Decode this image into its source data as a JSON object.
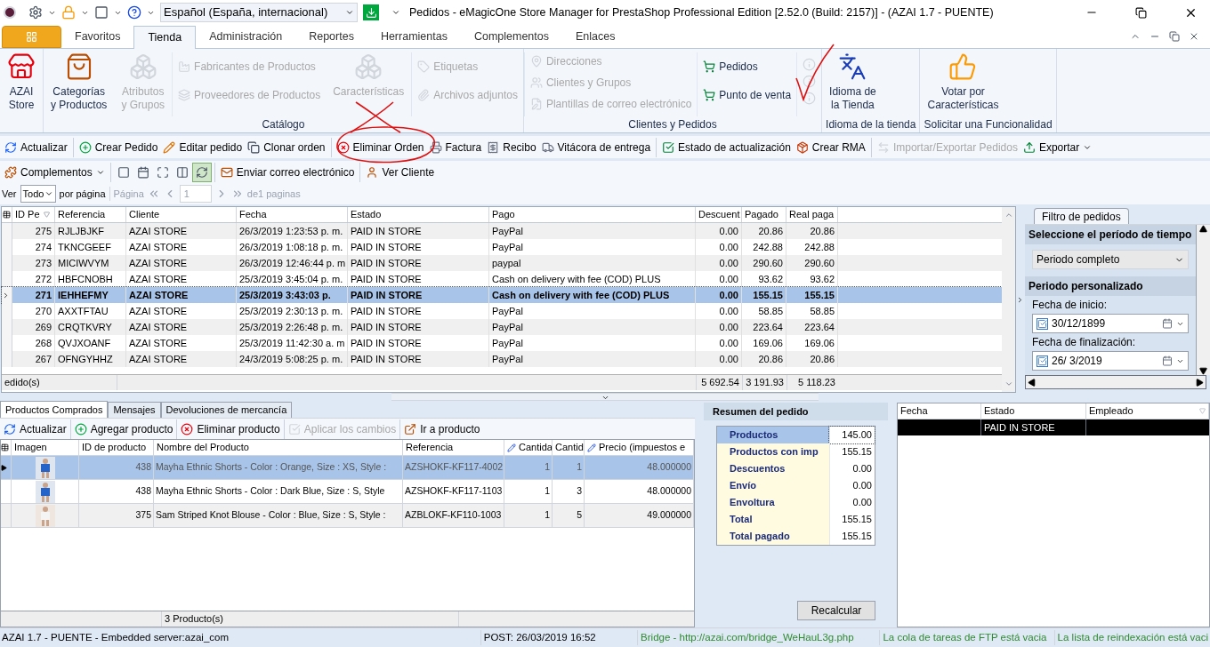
{
  "title_bar": {
    "language": "Español (España, internacional)",
    "title": "Pedidos - eMagicOne Store Manager for PrestaShop Professional Edition [2.52.0 (Build: 2157)] - (AZAI 1.7 - PUENTE)"
  },
  "ribbon": {
    "tabs": [
      {
        "label": "Favoritos",
        "selected": false
      },
      {
        "label": "Tienda",
        "selected": true
      },
      {
        "label": "Administración",
        "selected": false
      },
      {
        "label": "Reportes",
        "selected": false
      },
      {
        "label": "Herramientas",
        "selected": false
      },
      {
        "label": "Complementos",
        "selected": false
      },
      {
        "label": "Enlaces",
        "selected": false
      }
    ],
    "groups": [
      {
        "columns": [
          {
            "kind": "large",
            "label": "AZAI\nStore",
            "disabled": false
          }
        ]
      },
      {
        "label": "Catálogo",
        "columns": [
          {
            "kind": "large",
            "label": "Categorías\ny Productos",
            "disabled": false
          },
          {
            "kind": "large",
            "label": "Atributos\ny Grupos",
            "disabled": true
          },
          {
            "kind": "stack",
            "items": [
              {
                "label": "Fabricantes de Productos",
                "disabled": true
              },
              {
                "label": "Proveedores de Productos",
                "disabled": true
              }
            ]
          },
          {
            "kind": "large",
            "label": "Características",
            "disabled": true
          },
          {
            "kind": "stack",
            "items": [
              {
                "label": "Etiquetas",
                "disabled": true
              },
              {
                "label": "Archivos adjuntos",
                "disabled": true
              }
            ]
          }
        ]
      },
      {
        "label": "Clientes y Pedidos",
        "columns": [
          {
            "kind": "stack",
            "items": [
              {
                "label": "Direcciones",
                "disabled": true
              },
              {
                "label": "Clientes y Grupos",
                "disabled": true
              },
              {
                "label": "Plantillas de correo electrónico",
                "disabled": true
              }
            ]
          },
          {
            "kind": "stack",
            "items": [
              {
                "label": "Pedidos",
                "disabled": false
              },
              {
                "label": "Punto de venta",
                "disabled": false
              }
            ]
          },
          {
            "kind": "icons",
            "items": [
              {
                "disabled": true
              },
              {
                "disabled": true
              },
              {
                "disabled": true
              }
            ]
          }
        ]
      },
      {
        "label": "Idioma de la tienda",
        "columns": [
          {
            "kind": "large",
            "label": "Idioma de\nla Tienda",
            "disabled": false
          }
        ]
      },
      {
        "label": "Solicitar una Funcionalidad",
        "columns": [
          {
            "kind": "large",
            "label": "Votar por\nCaracterísticas",
            "disabled": false
          }
        ]
      }
    ]
  },
  "toolbar_orders": [
    [
      {
        "label": "Actualizar",
        "disabled": false,
        "dropdown": false
      }
    ],
    [
      {
        "label": "Crear Pedido",
        "disabled": false,
        "dropdown": false
      },
      {
        "label": "Editar pedido",
        "disabled": false,
        "dropdown": false
      },
      {
        "label": "Clonar orden",
        "disabled": false,
        "dropdown": false
      }
    ],
    [
      {
        "label": "Eliminar Orden",
        "disabled": false,
        "dropdown": false
      },
      {
        "label": "Factura",
        "disabled": false,
        "dropdown": false
      },
      {
        "label": "Recibo",
        "disabled": false,
        "dropdown": false
      },
      {
        "label": "Vitácora de entrega",
        "disabled": false,
        "dropdown": false
      }
    ],
    [
      {
        "label": "Estado de actualización",
        "disabled": false,
        "dropdown": false
      },
      {
        "label": "Crear RMA",
        "disabled": false,
        "dropdown": false
      }
    ],
    [
      {
        "label": "Importar/Exportar Pedidos",
        "disabled": true,
        "dropdown": false
      },
      {
        "label": "Exportar",
        "disabled": false,
        "dropdown": true
      }
    ]
  ],
  "toolbar_extra": [
    [
      {
        "kind": "text",
        "label": "Complementos",
        "dropdown": true,
        "pressed": false
      }
    ],
    [
      {
        "kind": "icon",
        "pressed": false
      },
      {
        "kind": "icon",
        "pressed": false
      },
      {
        "kind": "icon",
        "pressed": false
      },
      {
        "kind": "icon",
        "pressed": false
      },
      {
        "kind": "icon",
        "pressed": true
      }
    ],
    [
      {
        "kind": "text",
        "label": "Enviar correo electrónico",
        "dropdown": false,
        "pressed": false
      }
    ],
    [
      {
        "kind": "text",
        "label": "Ver Cliente",
        "dropdown": false,
        "pressed": false
      }
    ]
  ],
  "pager": {
    "show_label": "Ver",
    "page_size": "Todo",
    "per_page": "por página",
    "page_label": "Página",
    "page_value": "1",
    "of_pages": "de1 paginas"
  },
  "orders": {
    "columns": [
      "ID Pe",
      "Referencia",
      "Cliente",
      "Fecha",
      "Estado",
      "Pago",
      "Descuent",
      "Pagado",
      "Real paga"
    ],
    "rows": [
      {
        "cells": [
          "275",
          "RJLJBJKF",
          "AZAI  STORE",
          "26/3/2019 1:23:53 p. m.",
          "PAID IN STORE",
          "PayPal",
          "0.00",
          "20.86",
          "20.86"
        ],
        "selected": false
      },
      {
        "cells": [
          "274",
          "TKNCGEEF",
          "AZAI  STORE",
          "26/3/2019 1:08:18 p. m.",
          "PAID IN STORE",
          "PayPal",
          "0.00",
          "242.88",
          "242.88"
        ],
        "selected": false
      },
      {
        "cells": [
          "273",
          "MICIWVYM",
          "AZAI  STORE",
          "26/3/2019 12:46:44 p. m",
          "PAID IN STORE",
          "paypal",
          "0.00",
          "290.60",
          "290.60"
        ],
        "selected": false
      },
      {
        "cells": [
          "272",
          "HBFCNOBH",
          "AZAI  STORE",
          "25/3/2019 3:45:04 p. m.",
          "PAID IN STORE",
          "Cash on delivery with fee (COD) PLUS",
          "0.00",
          "93.62",
          "93.62"
        ],
        "selected": false
      },
      {
        "cells": [
          "271",
          "IEHHEFMY",
          "AZAI  STORE",
          "25/3/2019 3:43:03 p.",
          "PAID IN STORE",
          "Cash on delivery with fee (COD) PLUS",
          "0.00",
          "155.15",
          "155.15"
        ],
        "selected": true
      },
      {
        "cells": [
          "270",
          "AXXTFTAU",
          "AZAI  STORE",
          "25/3/2019 2:30:13 p. m.",
          "PAID IN STORE",
          "PayPal",
          "0.00",
          "58.85",
          "58.85"
        ],
        "selected": false
      },
      {
        "cells": [
          "269",
          "CRQTKVRY",
          "AZAI  STORE",
          "25/3/2019 2:26:48 p. m.",
          "PAID IN STORE",
          "PayPal",
          "0.00",
          "223.64",
          "223.64"
        ],
        "selected": false
      },
      {
        "cells": [
          "268",
          "QVJXOANF",
          "AZAI  STORE",
          "25/3/2019 11:42:30 a. m",
          "PAID IN STORE",
          "PayPal",
          "0.00",
          "169.06",
          "169.06"
        ],
        "selected": false
      },
      {
        "cells": [
          "267",
          "OFNGYHHZ",
          "AZAI  STORE",
          "24/3/2019 5:08:25 p. m.",
          "PAID IN STORE",
          "PayPal",
          "0.00",
          "20.86",
          "20.86"
        ],
        "selected": false
      }
    ],
    "footer": {
      "count": "edido(s)",
      "totals": [
        "5 692.54",
        "3 191.93",
        "5 118.23"
      ]
    }
  },
  "filter": {
    "tab": "Filtro de pedidos",
    "period_title": "Seleccione el período de tiempo",
    "period": "Periodo completo",
    "custom_title": "Periodo personalizado",
    "start_label": "Fecha de inicio:",
    "start": {
      "value": "30/12/1899",
      "checked": true
    },
    "end_label": "Fecha de finalización:",
    "end": {
      "value": "26/  3/2019",
      "checked": true
    }
  },
  "bottom_tabs": [
    {
      "label": "Productos Comprados",
      "selected": true
    },
    {
      "label": "Mensajes",
      "selected": false
    },
    {
      "label": "Devoluciones de mercancía",
      "selected": false
    }
  ],
  "products_toolbar": [
    {
      "label": "Actualizar",
      "disabled": false
    },
    {
      "label": "Agregar producto",
      "disabled": false
    },
    {
      "label": "Eliminar producto",
      "disabled": false
    },
    {
      "label": "Aplicar los cambios",
      "disabled": true
    },
    {
      "label": "Ir a producto",
      "disabled": false
    }
  ],
  "products": {
    "columns": [
      {
        "label": "Imagen",
        "editable": false
      },
      {
        "label": "ID de producto",
        "editable": false
      },
      {
        "label": "Nombre del Producto",
        "editable": false
      },
      {
        "label": "Referencia",
        "editable": false
      },
      {
        "label": "Cantida",
        "editable": true
      },
      {
        "label": "Cantid",
        "editable": false
      },
      {
        "label": "Precio (impuestos e",
        "editable": true
      }
    ],
    "rows": [
      {
        "product_id": "438",
        "name": "Mayha Ethnic Shorts - Color : Orange, Size : XS, Style :",
        "reference": "AZSHOKF-KF117-4002",
        "quantity": "1",
        "quantity_2": "1",
        "price": "48.000000",
        "selected": true
      },
      {
        "product_id": "438",
        "name": "Mayha Ethnic Shorts - Color : Dark Blue, Size : S, Style",
        "reference": "AZSHOKF-KF117-1103",
        "quantity": "1",
        "quantity_2": "3",
        "price": "48.000000",
        "selected": false
      },
      {
        "product_id": "375",
        "name": "Sam Striped Knot Blouse - Color : Blue, Size : S, Style :",
        "reference": "AZBLOKF-KF110-1003",
        "quantity": "1",
        "quantity_2": "5",
        "price": "49.000000",
        "selected": false
      }
    ],
    "footer": "3 Producto(s)"
  },
  "summary": {
    "title": "Resumen del pedido",
    "rows": [
      {
        "label": "Productos",
        "value": "145.00",
        "selected": true
      },
      {
        "label": "Productos con imp",
        "value": "155.15",
        "selected": false
      },
      {
        "label": "Descuentos",
        "value": "0.00",
        "selected": false
      },
      {
        "label": "Envío",
        "value": "0.00",
        "selected": false
      },
      {
        "label": "Envoltura",
        "value": "0.00",
        "selected": false
      },
      {
        "label": "Total",
        "value": "155.15",
        "selected": false
      },
      {
        "label": "Total pagado",
        "value": "155.15",
        "selected": false
      }
    ],
    "button": "Recalcular"
  },
  "history": {
    "columns": [
      "Fecha",
      "Estado",
      "Empleado"
    ],
    "rows": [
      {
        "estado": "PAID IN STORE",
        "selected": true
      }
    ]
  },
  "status_bar": [
    {
      "text": "AZAI 1.7 - PUENTE - Embedded server:azai_com",
      "color": "#000000"
    },
    {
      "text": "POST: 26/03/2019 16:52",
      "color": "#000000"
    },
    {
      "text": "Bridge - http://azai.com/bridge_WeHauL3g.php",
      "color": "#2e8b2e"
    },
    {
      "text": "La cola de tareas de FTP está vacia",
      "color": "#2e8b2e"
    },
    {
      "text": "La lista de reindexación está vaci",
      "color": "#2e8b2e"
    }
  ]
}
